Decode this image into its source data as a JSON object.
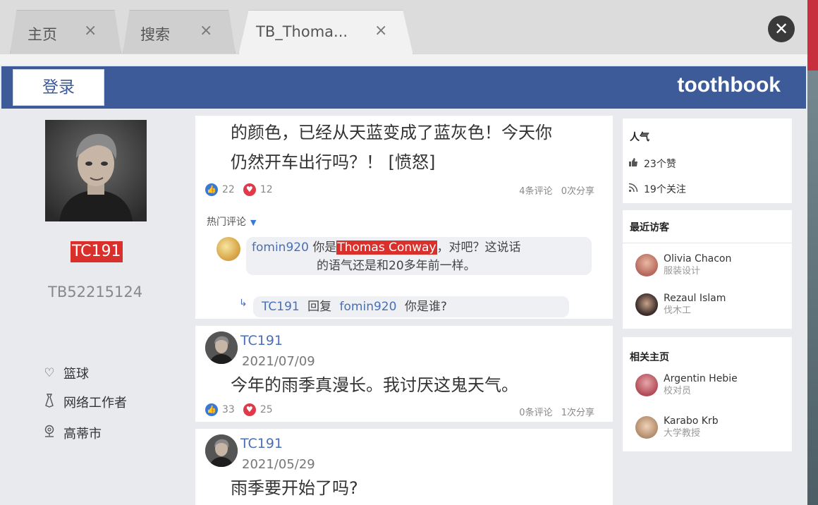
{
  "tabs": [
    {
      "label": "主页",
      "close": "×"
    },
    {
      "label": "搜索",
      "close": "×"
    },
    {
      "label": "TB_Thoma...",
      "close": "×"
    }
  ],
  "window_close": "✕",
  "header": {
    "login_label": "登录",
    "brand": "toothbook"
  },
  "profile": {
    "username": "TC191",
    "user_id": "TB52215124",
    "hobby": "篮球",
    "job": "网络工作者",
    "city": "高蒂市"
  },
  "feed": {
    "post1": {
      "text_line1": "的颜色，已经从天蓝变成了蓝灰色！今天你",
      "text_line2": "仍然开车出行吗？！ [愤怒]",
      "likes": "22",
      "hearts": "12",
      "comments": "4条评论",
      "shares": "0次分享",
      "hot_comments_label": "热门评论",
      "comment": {
        "author": "fomin920",
        "prefix": "你是",
        "highlight": "Thomas Conway",
        "suffix": "，对吧？这说话",
        "line2": "的语气还是和20多年前一样。"
      },
      "reply": {
        "author": "TC191",
        "verb": "回复",
        "target": "fomin920",
        "text": "你是谁?"
      }
    },
    "post2": {
      "author": "TC191",
      "date": "2021/07/09",
      "text": "今年的雨季真漫长。我讨厌这鬼天气。",
      "likes": "33",
      "hearts": "25",
      "comments": "0条评论",
      "shares": "1次分享"
    },
    "post3": {
      "author": "TC191",
      "date": "2021/05/29",
      "text": "雨季要开始了吗?"
    }
  },
  "sidebar": {
    "popularity_title": "人气",
    "likes_count": "23个赞",
    "followers_count": "19个关注",
    "recent_visitors_title": "最近访客",
    "visitors": [
      {
        "name": "Olivia Chacon",
        "role": "服装设计",
        "color": "#b5655a"
      },
      {
        "name": "Rezaul Islam",
        "role": "伐木工",
        "color": "#3b2c2a"
      }
    ],
    "related_title": "相关主页",
    "related": [
      {
        "name": "Argentin Hebie",
        "role": "校对员",
        "color": "#b04a55"
      },
      {
        "name": "Karabo Krb",
        "role": "大学教授",
        "color": "#b08a6a"
      }
    ]
  }
}
